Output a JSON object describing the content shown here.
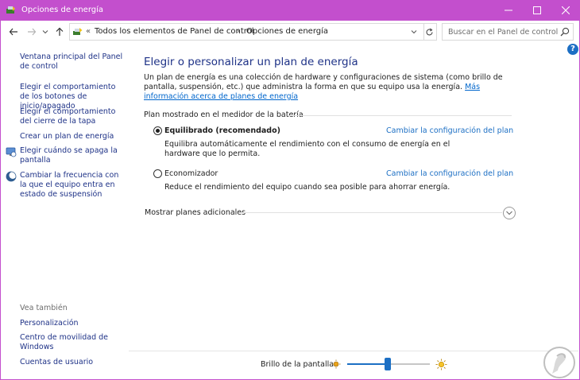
{
  "window": {
    "title": "Opciones de energía",
    "accent_color": "#c34fcd"
  },
  "address_bar": {
    "crumbs": [
      "Todos los elementos de Panel de control",
      "Opciones de energía"
    ],
    "prefix": "«",
    "separator": "›"
  },
  "search": {
    "placeholder": "Buscar en el Panel de control"
  },
  "sidebar": {
    "items": [
      {
        "label": "Ventana principal del Panel de control",
        "icon": "none"
      },
      {
        "label": "Elegir el comportamiento de los botones de inicio/apagado",
        "icon": "none"
      },
      {
        "label": "Elegir el comportamiento del cierre de la tapa",
        "icon": "none"
      },
      {
        "label": "Crear un plan de energía",
        "icon": "none"
      },
      {
        "label": "Elegir cuándo se apaga la pantalla",
        "icon": "display-power-icon"
      },
      {
        "label": "Cambiar la frecuencia con la que el equipo entra en estado de suspensión",
        "icon": "sleep-moon-icon"
      }
    ],
    "see_also": {
      "label": "Vea también",
      "items": [
        "Personalización",
        "Centro de movilidad de Windows",
        "Cuentas de usuario"
      ]
    }
  },
  "main": {
    "title": "Elegir o personalizar un plan de energía",
    "description": "Un plan de energía es una colección de hardware y configuraciones de sistema (como brillo de pantalla, suspensión, etc.) que administra la forma en que su equipo usa la energía.",
    "more_info_link": "Más información acerca de planes de energía",
    "group_label": "Plan mostrado en el medidor de la batería",
    "plans": [
      {
        "name": "Equilibrado (recomendado)",
        "selected": true,
        "link": "Cambiar la configuración del plan",
        "description": "Equilibra automáticamente el rendimiento con el consumo de energía en el hardware que lo permita."
      },
      {
        "name": "Economizador",
        "selected": false,
        "link": "Cambiar la configuración del plan",
        "description": "Reduce el rendimiento del equipo cuando sea posible para ahorrar energía."
      }
    ],
    "more_plans_label": "Mostrar planes adicionales"
  },
  "brightness": {
    "label": "Brillo de la pantalla:",
    "level_percent": 49
  },
  "colors": {
    "link_dark": "#1e3287",
    "link_blue": "#1c6fc4",
    "slider": "#1c6fc4"
  }
}
